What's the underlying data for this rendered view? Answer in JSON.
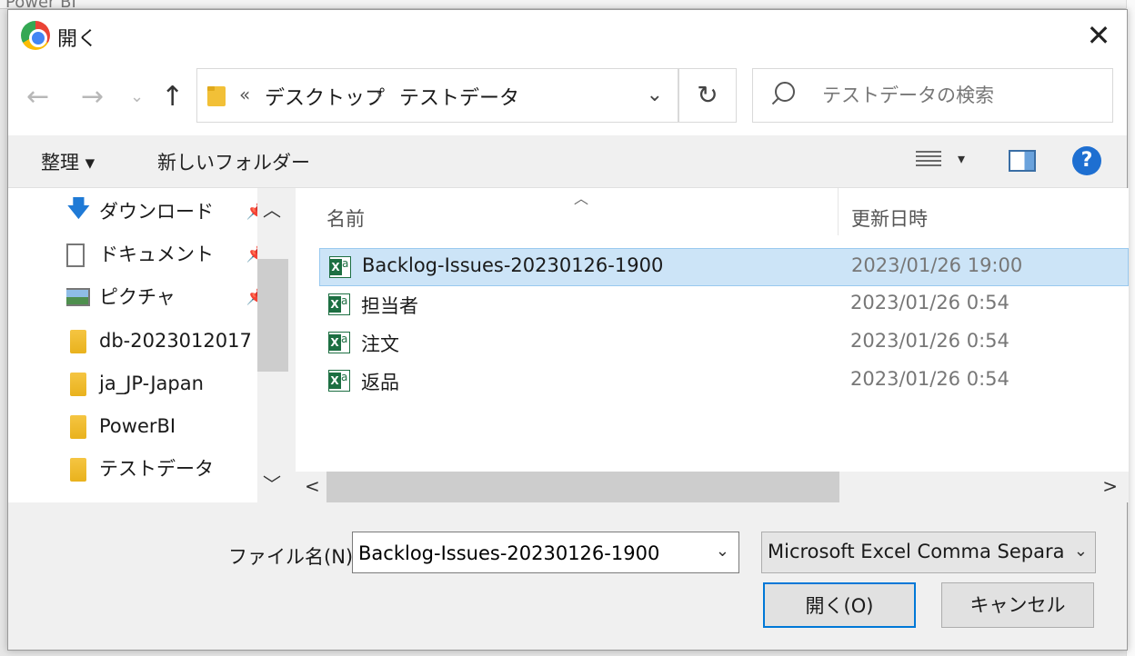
{
  "background": {
    "app_title": "Power BI"
  },
  "window": {
    "title": "開く",
    "close": "✕"
  },
  "nav": {
    "back": "←",
    "forward": "→",
    "history": "⌄",
    "up": "↑",
    "breadcrumb_overflow": "«",
    "path": [
      "デスクトップ",
      "テストデータ"
    ],
    "path_separator": "›",
    "dropdown": "⌄",
    "refresh": "↻"
  },
  "search": {
    "placeholder": "テストデータの検索"
  },
  "toolbar": {
    "organize": "整理 ▾",
    "new_folder": "新しいフォルダー",
    "view_dropdown": "▾",
    "help": "?"
  },
  "sidebar": {
    "items": [
      {
        "label": "ダウンロード",
        "icon": "download-icon",
        "pinned": true
      },
      {
        "label": "ドキュメント",
        "icon": "document-icon",
        "pinned": true
      },
      {
        "label": "ピクチャ",
        "icon": "pictures-icon",
        "pinned": true
      },
      {
        "label": "db-2023012017",
        "icon": "folder-icon",
        "pinned": false
      },
      {
        "label": "ja_JP-Japan",
        "icon": "folder-icon",
        "pinned": false
      },
      {
        "label": "PowerBI",
        "icon": "folder-icon",
        "pinned": false
      },
      {
        "label": "テストデータ",
        "icon": "folder-icon",
        "pinned": false
      }
    ],
    "pin_glyph": "📌",
    "scroll_up": "︿",
    "scroll_down": "﹀"
  },
  "filelist": {
    "sort_indicator": "︿",
    "columns": {
      "name": "名前",
      "modified": "更新日時"
    },
    "rows": [
      {
        "name": "Backlog-Issues-20230126-1900",
        "modified": "2023/01/26 19:00",
        "selected": true
      },
      {
        "name": "担当者",
        "modified": "2023/01/26 0:54",
        "selected": false
      },
      {
        "name": "注文",
        "modified": "2023/01/26 0:54",
        "selected": false
      },
      {
        "name": "返品",
        "modified": "2023/01/26 0:54",
        "selected": false
      }
    ],
    "scroll_left": "<",
    "scroll_right": ">"
  },
  "footer": {
    "filename_label": "ファイル名(N):",
    "filename_value": "Backlog-Issues-20230126-1900",
    "filename_drop": "⌄",
    "filetype": "Microsoft Excel Comma Separat",
    "filetype_drop": "⌄",
    "open_button": "開く(O)",
    "cancel_button": "キャンセル"
  },
  "colors": {
    "selection": "#cce4f7",
    "accent": "#0078d7",
    "excel": "#1d6f42",
    "folder": "#f5c542"
  }
}
